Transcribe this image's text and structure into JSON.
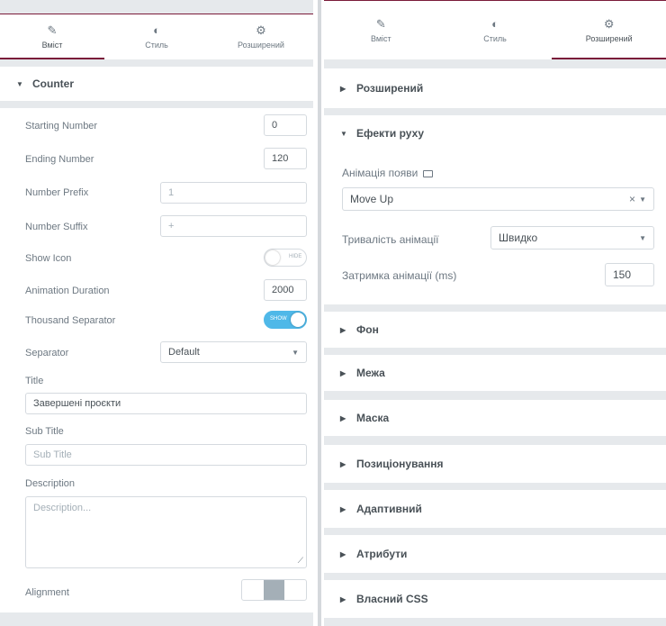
{
  "left": {
    "tabs": [
      {
        "icon": "pencil-icon",
        "glyph": "✎",
        "label": "Вміст",
        "active": true
      },
      {
        "icon": "contrast-icon",
        "glyph": "◐",
        "label": "Стиль",
        "active": false
      },
      {
        "icon": "gear-icon",
        "glyph": "⚙",
        "label": "Розширений",
        "active": false
      }
    ],
    "section": {
      "label": "Counter",
      "caret": "▼"
    },
    "fields": {
      "starting_number": {
        "label": "Starting Number",
        "value": "0"
      },
      "ending_number": {
        "label": "Ending Number",
        "value": "120"
      },
      "number_prefix": {
        "label": "Number Prefix",
        "value": "1"
      },
      "number_suffix": {
        "label": "Number Suffix",
        "value": "+"
      },
      "show_icon": {
        "label": "Show Icon",
        "toggle_text": "HIDE",
        "on": false
      },
      "animation_duration": {
        "label": "Animation Duration",
        "value": "2000"
      },
      "thousand_separator": {
        "label": "Thousand Separator",
        "toggle_text": "SHOW",
        "on": true
      },
      "separator": {
        "label": "Separator",
        "value": "Default",
        "arrow": "▼"
      },
      "title": {
        "label": "Title",
        "value": "Завершені проєкти"
      },
      "sub_title": {
        "label": "Sub Title",
        "placeholder": "Sub Title"
      },
      "description": {
        "label": "Description",
        "placeholder": "Description...",
        "resize": "⟋"
      },
      "alignment": {
        "label": "Alignment"
      }
    }
  },
  "right": {
    "tabs": [
      {
        "icon": "pencil-icon",
        "glyph": "✎",
        "label": "Вміст",
        "active": false
      },
      {
        "icon": "contrast-icon",
        "glyph": "◐",
        "label": "Стиль",
        "active": false
      },
      {
        "icon": "gear-icon",
        "glyph": "⚙",
        "label": "Розширений",
        "active": true
      }
    ],
    "sections": {
      "advanced": {
        "label": "Розширений",
        "caret": "▶"
      },
      "motion": {
        "label": "Ефекти руху",
        "caret": "▼"
      },
      "background": {
        "label": "Фон",
        "caret": "▶"
      },
      "border": {
        "label": "Межа",
        "caret": "▶"
      },
      "mask": {
        "label": "Маска",
        "caret": "▶"
      },
      "positioning": {
        "label": "Позиціонування",
        "caret": "▶"
      },
      "responsive": {
        "label": "Адаптивний",
        "caret": "▶"
      },
      "attributes": {
        "label": "Атрибути",
        "caret": "▶"
      },
      "custom_css": {
        "label": "Власний CSS",
        "caret": "▶"
      }
    },
    "motion": {
      "entrance_label": "Анімація появи",
      "entrance_value": "Move Up",
      "clear": "×",
      "arrow": "▼",
      "duration_label": "Тривалість анімації",
      "duration_value": "Швидко",
      "delay_label": "Затримка анімації (ms)",
      "delay_value": "150"
    }
  }
}
